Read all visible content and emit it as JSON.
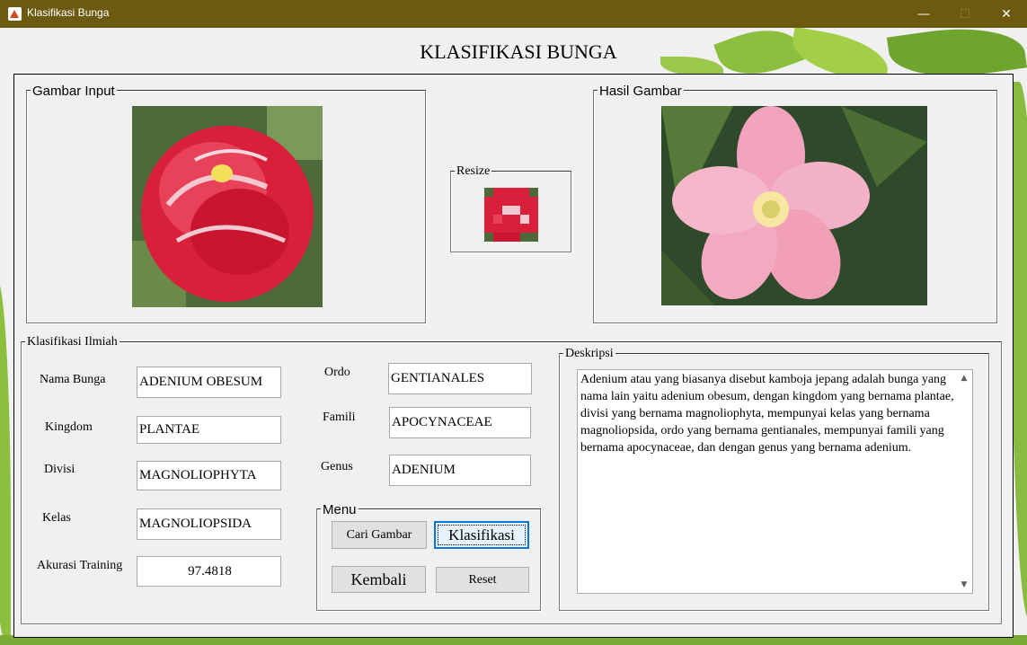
{
  "window": {
    "title": "Klasifikasi Bunga",
    "controls": {
      "minimize": "—",
      "maximize": "☐",
      "close": "✕"
    }
  },
  "header": {
    "title": "KLASIFIKASI BUNGA"
  },
  "panels": {
    "input": {
      "label": "Gambar Input",
      "image": "red double adenium flower"
    },
    "resize": {
      "label": "Resize",
      "image": "pixelated red adenium flower"
    },
    "result": {
      "label": "Hasil Gambar",
      "image": "pink adenium obesum flower"
    }
  },
  "klasifikasi": {
    "label": "Klasifikasi Ilmiah",
    "fields": {
      "nama_bunga": {
        "label": "Nama Bunga",
        "value": "ADENIUM OBESUM"
      },
      "kingdom": {
        "label": "Kingdom",
        "value": "PLANTAE"
      },
      "divisi": {
        "label": "Divisi",
        "value": "MAGNOLIOPHYTA"
      },
      "kelas": {
        "label": "Kelas",
        "value": "MAGNOLIOPSIDA"
      },
      "akurasi": {
        "label": "Akurasi Training",
        "value": "97.4818"
      },
      "ordo": {
        "label": "Ordo",
        "value": "GENTIANALES"
      },
      "famili": {
        "label": "Famili",
        "value": "APOCYNACEAE"
      },
      "genus": {
        "label": "Genus",
        "value": "ADENIUM"
      }
    }
  },
  "menu": {
    "label": "Menu",
    "cari_gambar": "Cari Gambar",
    "klasifikasi": "Klasifikasi",
    "kembali": "Kembali",
    "reset": "Reset"
  },
  "deskripsi": {
    "label": "Deskripsi",
    "text": "Adenium atau yang biasanya disebut kamboja jepang adalah bunga yang nama lain yaitu adenium obesum, dengan kingdom yang bernama plantae, divisi yang bernama magnoliophyta, mempunyai kelas yang bernama magnoliopsida, ordo yang bernama gentianales, mempunyai famili yang bernama apocynaceae, dan dengan genus yang bernama adenium.",
    "scroll_up": "▲",
    "scroll_down": "▼"
  },
  "colors": {
    "titlebar": "#6b5a10",
    "leaf_green": "#7fb33a",
    "flower_red": "#d8203a",
    "flower_pink": "#f2a3bd"
  }
}
